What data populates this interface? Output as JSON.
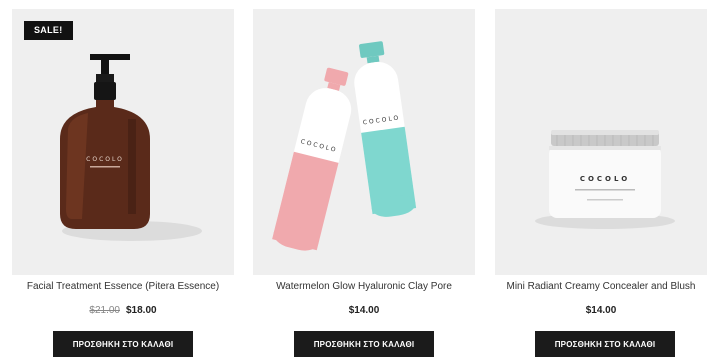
{
  "products": [
    {
      "title": "Facial Treatment Essence (Pitera Essence)",
      "old_price": "$21.00",
      "price": "$18.00",
      "badge": "SALE!",
      "button_label": "ΠΡΟΣΘΗΚΗ ΣΤΟ ΚΑΛΑΘΙ",
      "brand_on_pack": "COCOLO"
    },
    {
      "title": "Watermelon Glow Hyaluronic Clay Pore",
      "price": "$14.00",
      "button_label": "ΠΡΟΣΘΗΚΗ ΣΤΟ ΚΑΛΑΘΙ",
      "brand_on_pack": "COCOLO"
    },
    {
      "title": "Mini Radiant Creamy Concealer and Blush",
      "price": "$14.00",
      "button_label": "ΠΡΟΣΘΗΚΗ ΣΤΟ ΚΑΛΑΘΙ",
      "brand_on_pack": "COCOLO"
    }
  ],
  "colors": {
    "image_bg": "#efefef",
    "button_bg": "#1b1b1b",
    "bottle_pink": "#f0a9ad",
    "bottle_mint": "#7fd7cf",
    "amber": "#5a2a1a"
  }
}
